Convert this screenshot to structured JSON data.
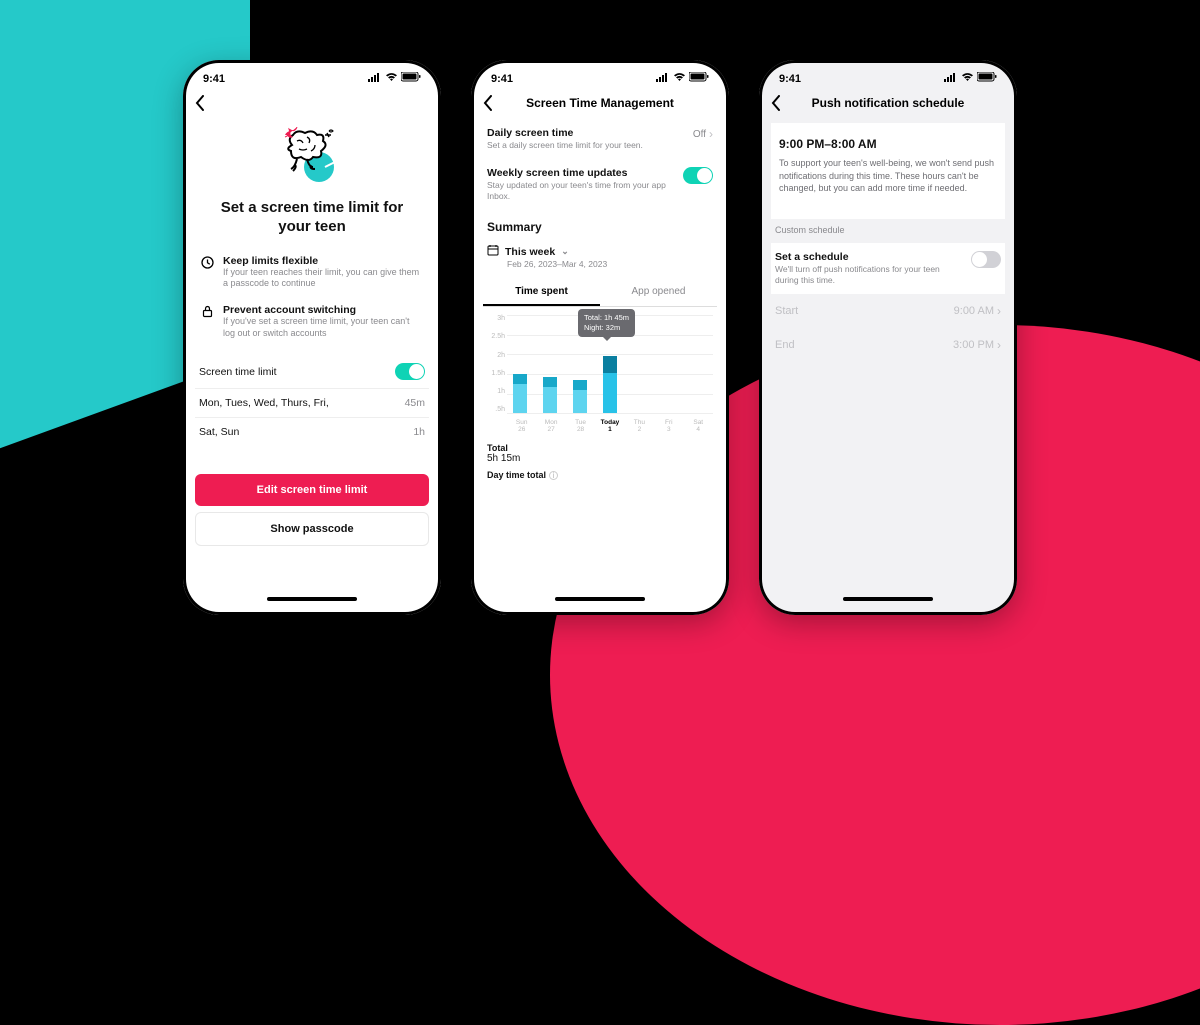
{
  "statusbar": {
    "time": "9:41"
  },
  "phone1": {
    "title": "Set a screen time limit for your teen",
    "feat1": {
      "title": "Keep limits flexible",
      "desc": "If your teen reaches their limit, you can give them a passcode to continue"
    },
    "feat2": {
      "title": "Prevent account switching",
      "desc": "If you've set a screen time limit, your teen can't log out or switch accounts"
    },
    "toggle_label": "Screen time limit",
    "row1": {
      "days": "Mon, Tues, Wed, Thurs, Fri,",
      "val": "45m"
    },
    "row2": {
      "days": "Sat, Sun",
      "val": "1h"
    },
    "btn_primary": "Edit screen time limit",
    "btn_secondary": "Show passcode"
  },
  "phone2": {
    "nav_title": "Screen Time Management",
    "daily": {
      "label": "Daily screen time",
      "desc": "Set a daily screen time limit for your teen.",
      "value": "Off"
    },
    "weekly": {
      "label": "Weekly screen time updates",
      "desc": "Stay updated on your teen's time from your app Inbox."
    },
    "summary_label": "Summary",
    "week_label": "This week",
    "week_range": "Feb 26, 2023–Mar 4, 2023",
    "tab_time": "Time spent",
    "tab_opened": "App opened",
    "tooltip_total": "Total: 1h 45m",
    "tooltip_night": "Night: 32m",
    "total_label": "Total",
    "total_value": "5h 15m",
    "day_total_label": "Day time total"
  },
  "phone3": {
    "nav_title": "Push notification schedule",
    "range": "9:00 PM–8:00 AM",
    "desc": "To support your teen's well-being, we won't send push notifications during this time. These hours can't be changed, but you can add more time if needed.",
    "custom_label": "Custom schedule",
    "set_label": "Set a schedule",
    "set_desc": "We'll turn off push notifications for your teen during this time.",
    "start_label": "Start",
    "start_val": "9:00 AM",
    "end_label": "End",
    "end_val": "3:00 PM"
  },
  "chart_data": {
    "type": "bar",
    "title": "Time spent",
    "ylabel": "hours",
    "ylim": [
      0,
      3
    ],
    "yticks": [
      "3h",
      "2.5h",
      "2h",
      "1.5h",
      "1h",
      ".5h"
    ],
    "categories": [
      "Sun 26",
      "Mon 27",
      "Tue 28",
      "Today 1",
      "Thu 2",
      "Fri 3",
      "Sat 4"
    ],
    "series": [
      {
        "name": "Day",
        "values": [
          0.9,
          0.8,
          0.7,
          1.22,
          0,
          0,
          0
        ]
      },
      {
        "name": "Night",
        "values": [
          0.3,
          0.3,
          0.3,
          0.53,
          0,
          0,
          0
        ]
      }
    ],
    "highlight_index": 3,
    "highlight_tooltip": {
      "total": "1h 45m",
      "night": "32m"
    },
    "totals": {
      "overall": "5h 15m"
    }
  }
}
